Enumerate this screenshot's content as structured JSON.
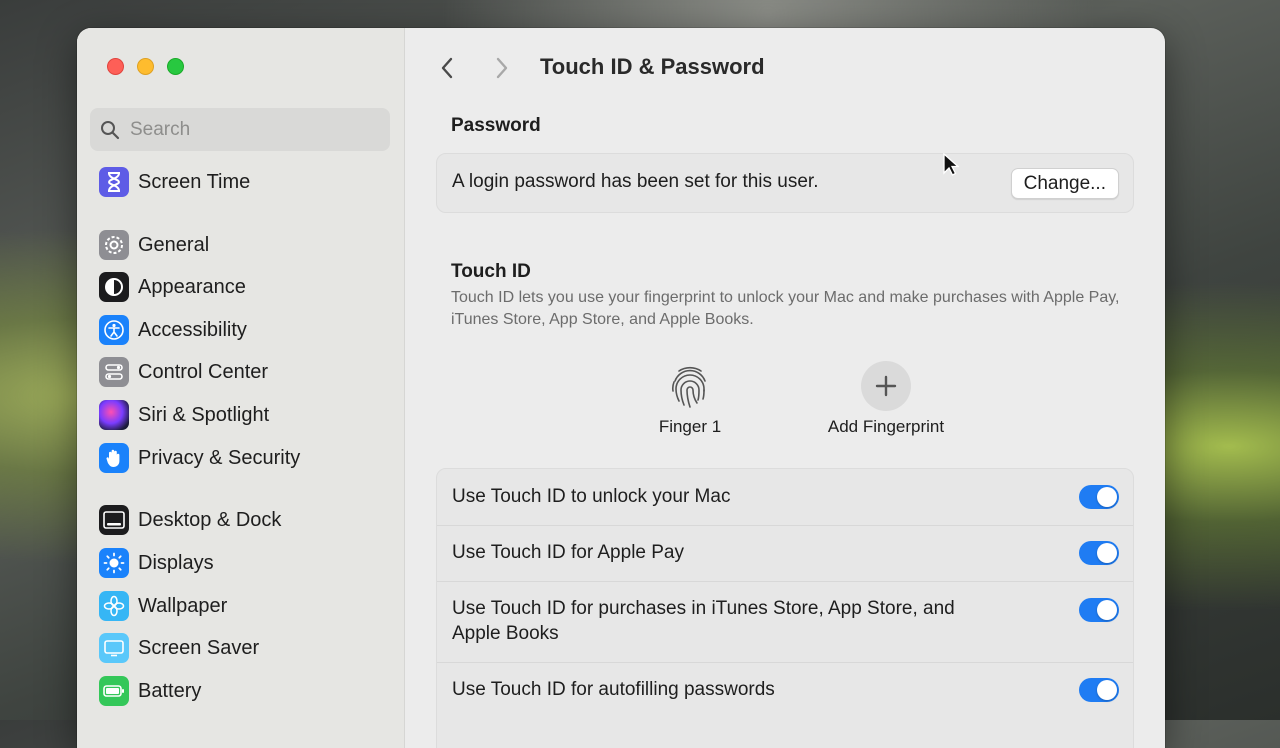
{
  "sidebar": {
    "search_placeholder": "Search",
    "items": [
      {
        "label": "Screen Time",
        "icon": "hourglass-icon"
      },
      {
        "label": "General",
        "icon": "gear-icon"
      },
      {
        "label": "Appearance",
        "icon": "appearance-icon"
      },
      {
        "label": "Accessibility",
        "icon": "accessibility-icon"
      },
      {
        "label": "Control Center",
        "icon": "control-center-icon"
      },
      {
        "label": "Siri & Spotlight",
        "icon": "siri-icon"
      },
      {
        "label": "Privacy & Security",
        "icon": "hand-icon"
      },
      {
        "label": "Desktop & Dock",
        "icon": "dock-icon"
      },
      {
        "label": "Displays",
        "icon": "sun-icon"
      },
      {
        "label": "Wallpaper",
        "icon": "flower-icon"
      },
      {
        "label": "Screen Saver",
        "icon": "screen-saver-icon"
      },
      {
        "label": "Battery",
        "icon": "battery-icon"
      }
    ]
  },
  "header": {
    "title": "Touch ID & Password"
  },
  "password": {
    "heading": "Password",
    "status_text": "A login password has been set for this user.",
    "change_label": "Change..."
  },
  "touch_id": {
    "heading": "Touch ID",
    "description": "Touch ID lets you use your fingerprint to unlock your Mac and make purchases with Apple Pay, iTunes Store, App Store, and Apple Books.",
    "finger_label": "Finger 1",
    "add_label": "Add Fingerprint"
  },
  "options": [
    {
      "label": "Use Touch ID to unlock your Mac",
      "enabled": true
    },
    {
      "label": "Use Touch ID for Apple Pay",
      "enabled": true
    },
    {
      "label": "Use Touch ID for purchases in iTunes Store, App Store, and Apple Books",
      "enabled": true
    },
    {
      "label": "Use Touch ID for autofilling passwords",
      "enabled": true
    }
  ],
  "colors": {
    "accent": "#1f7cf3"
  }
}
